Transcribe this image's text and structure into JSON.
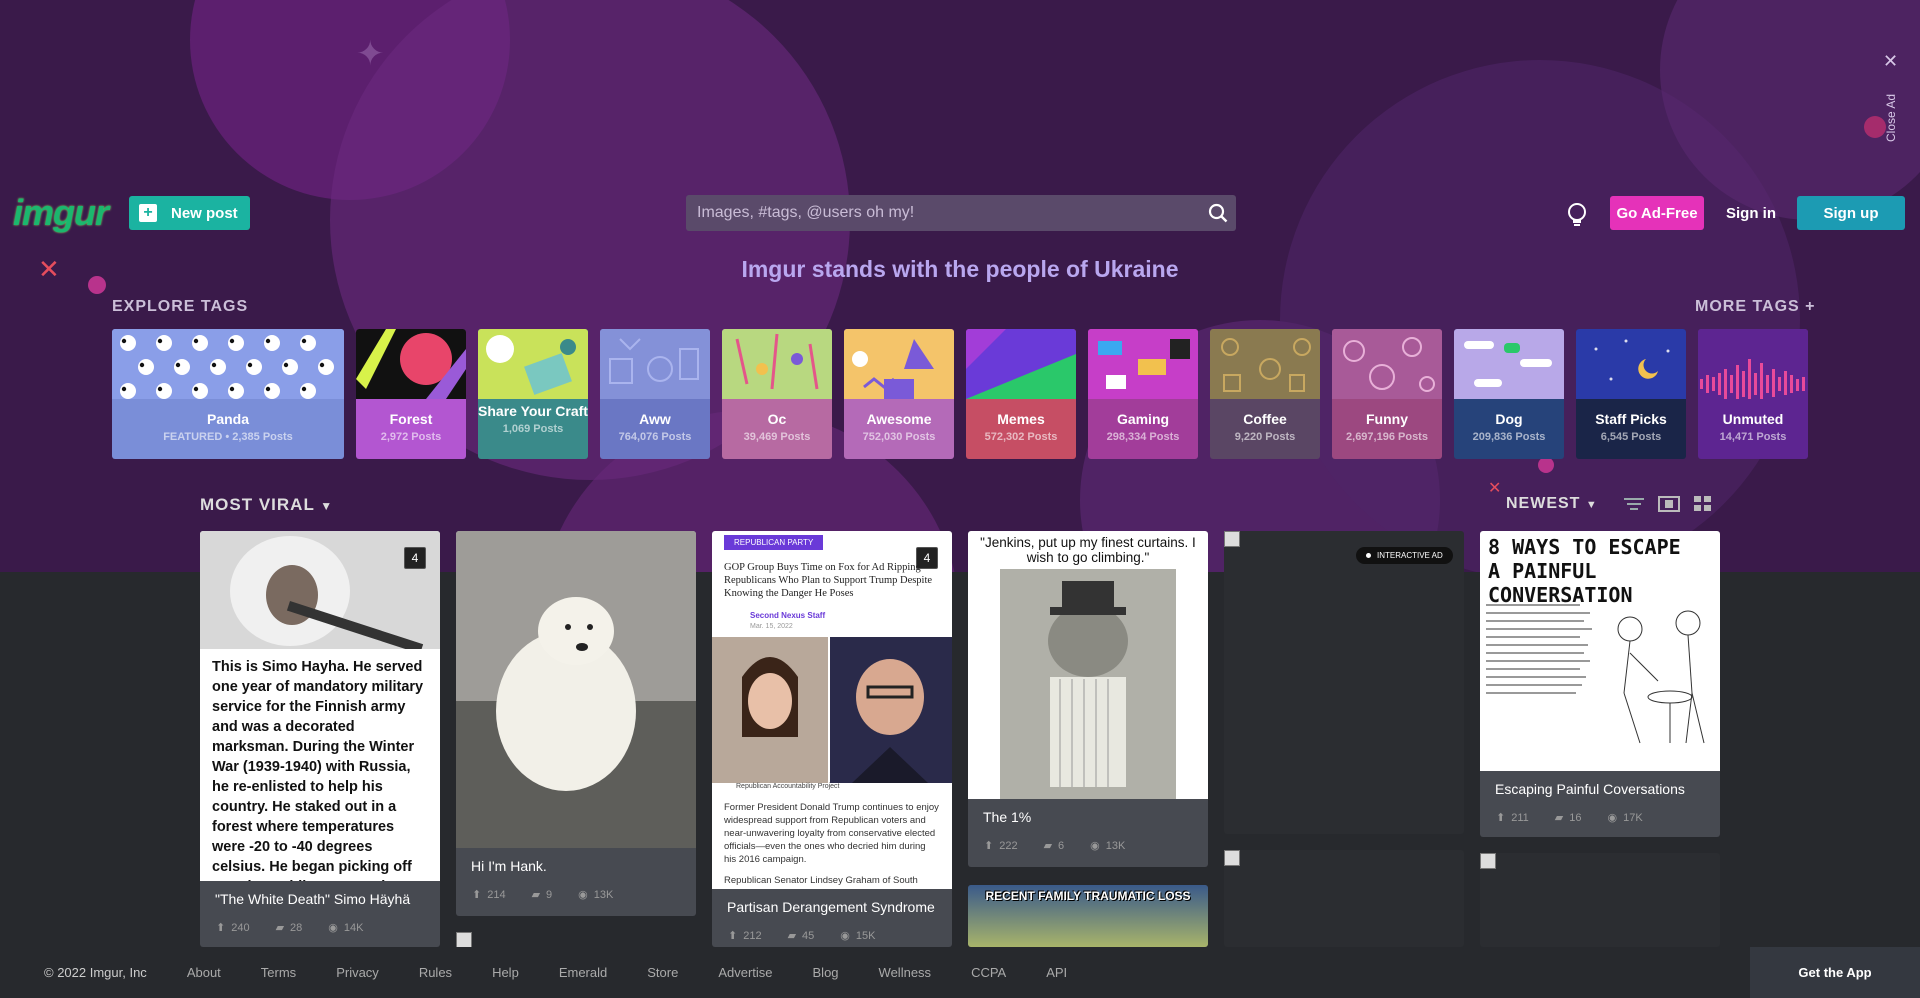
{
  "ad": {
    "close_label": "Close Ad"
  },
  "header": {
    "logo": "imgur",
    "new_post": "New post",
    "search_placeholder": "Images, #tags, @users oh my!",
    "go_ad_free": "Go Ad-Free",
    "sign_in": "Sign in",
    "sign_up": "Sign up"
  },
  "banner": "Imgur stands with the people of Ukraine",
  "explore": {
    "title": "EXPLORE TAGS",
    "more": "MORE TAGS +",
    "tags": [
      {
        "name": "Panda",
        "count": "FEATURED • 2,385 Posts",
        "color": "#7a8ed8"
      },
      {
        "name": "Forest",
        "count": "2,972 Posts",
        "color": "#b356d1"
      },
      {
        "name": "Share Your Craft",
        "count": "1,069 Posts",
        "color": "#3a8a8a"
      },
      {
        "name": "Aww",
        "count": "764,076 Posts",
        "color": "#6a77c4"
      },
      {
        "name": "Oc",
        "count": "39,469 Posts",
        "color": "#b76aa2"
      },
      {
        "name": "Awesome",
        "count": "752,030 Posts",
        "color": "#b46ab8"
      },
      {
        "name": "Memes",
        "count": "572,302 Posts",
        "color": "#c64e64"
      },
      {
        "name": "Gaming",
        "count": "298,334 Posts",
        "color": "#a23d9a"
      },
      {
        "name": "Coffee",
        "count": "9,220 Posts",
        "color": "#5a4664"
      },
      {
        "name": "Funny",
        "count": "2,697,196 Posts",
        "color": "#9c4880"
      },
      {
        "name": "Dog",
        "count": "209,836 Posts",
        "color": "#26437a"
      },
      {
        "name": "Staff Picks",
        "count": "6,545 Posts",
        "color": "#1a2548"
      },
      {
        "name": "Unmuted",
        "count": "14,471 Posts",
        "color": "#5d2591"
      }
    ]
  },
  "feed": {
    "sort": "MOST VIRAL",
    "order": "NEWEST",
    "interactive_ad": "INTERACTIVE AD",
    "posts": [
      {
        "title": "\"The White Death\" Simo Häyhä",
        "ups": "240",
        "comments": "28",
        "views": "14K",
        "badge": "4",
        "caption": "This is Simo Hayha. He served one year of mandatory military service for the Finnish army and was a decorated marksman. During the Winter War (1939-1940) with Russia, he re-enlisted to help his country. He staked out in a forest where temperatures were -20 to -40 degrees celsius. He began picking off Russian soldiers. Once they found out all their"
      },
      {
        "title": "Hi I'm Hank.",
        "ups": "214",
        "comments": "9",
        "views": "13K"
      },
      {
        "title": "Partisan Derangement Syndrome",
        "ups": "212",
        "comments": "45",
        "views": "15K",
        "badge": "4",
        "tagline": "REPUBLICAN PARTY",
        "headline": "GOP Group Buys Time on Fox for Ad Ripping Republicans Who Plan to Support Trump Despite Knowing the Danger He Poses",
        "source": "Second Nexus Staff",
        "date": "Mar. 15, 2022",
        "photo_credit": "Republican Accountability Project",
        "body": "Former President Donald Trump continues to enjoy widespread support from Republican voters and near-unwavering loyalty from conservative elected officials—even the ones who decried him during his 2016 campaign.",
        "body2": "Republican Senator Lindsey Graham of South"
      },
      {
        "title": "The 1%",
        "ups": "222",
        "comments": "6",
        "views": "13K",
        "caption": "\"Jenkins, put up my finest curtains. I wish to go climbing.\""
      },
      {
        "title": "Escaping Painful Coversations",
        "ups": "211",
        "comments": "16",
        "views": "17K",
        "comic_title": "8 WAYS TO ESCAPE A PAINFUL CONVERSATION"
      },
      {
        "caption": "RECENT FAMILY TRAUMATIC LOSS"
      }
    ]
  },
  "footer": {
    "copyright": "© 2022 Imgur, Inc",
    "links": [
      "About",
      "Terms",
      "Privacy",
      "Rules",
      "Help",
      "Emerald",
      "Store",
      "Advertise",
      "Blog",
      "Wellness",
      "CCPA",
      "API"
    ],
    "get_app": "Get the App"
  }
}
